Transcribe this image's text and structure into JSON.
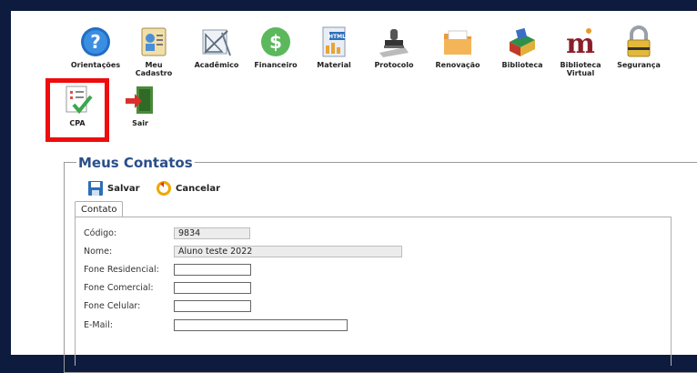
{
  "menu": {
    "items": [
      {
        "label": "Orientações",
        "icon": "help-icon"
      },
      {
        "label": "Meu Cadastro",
        "icon": "id-card-icon"
      },
      {
        "label": "Acadêmico",
        "icon": "drafting-tools-icon"
      },
      {
        "label": "Financeiro",
        "icon": "dollar-icon"
      },
      {
        "label": "Material",
        "icon": "html-file-icon"
      },
      {
        "label": "Protocolo",
        "icon": "stamp-icon"
      },
      {
        "label": "Renovação",
        "icon": "folder-icon"
      },
      {
        "label": "Biblioteca",
        "icon": "books-icon"
      },
      {
        "label": "Biblioteca Virtual",
        "icon": "m-logo-icon"
      },
      {
        "label": "Segurança",
        "icon": "padlock-icon"
      },
      {
        "label": "CPA",
        "icon": "checklist-icon"
      },
      {
        "label": "Sair",
        "icon": "exit-door-icon"
      }
    ]
  },
  "contacts": {
    "legend": "Meus Contatos",
    "save_label": "Salvar",
    "cancel_label": "Cancelar",
    "tab_label": "Contato",
    "fields": {
      "codigo": {
        "label": "Código:",
        "value": "9834"
      },
      "nome": {
        "label": "Nome:",
        "value": "Aluno teste 2022"
      },
      "fone_res": {
        "label": "Fone Residencial:",
        "value": ""
      },
      "fone_com": {
        "label": "Fone Comercial:",
        "value": ""
      },
      "fone_cel": {
        "label": "Fone Celular:",
        "value": ""
      },
      "email": {
        "label": "E-Mail:",
        "value": ""
      }
    }
  },
  "colors": {
    "background": "#0d1b3e",
    "highlight": "#ee0c0c",
    "legend": "#2a4f8a"
  }
}
